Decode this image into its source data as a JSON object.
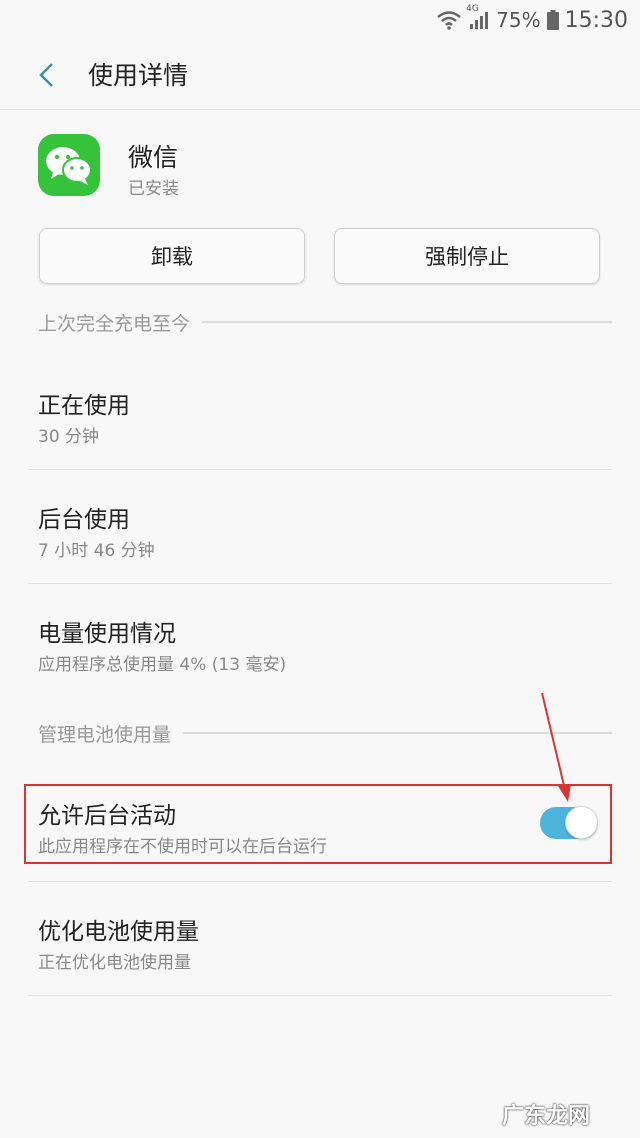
{
  "status_bar": {
    "network": "4G",
    "battery": "75%",
    "time": "15:30"
  },
  "header": {
    "title": "使用详情"
  },
  "app": {
    "name": "微信",
    "status": "已安装",
    "icon": "wechat-icon",
    "icon_color": "#35c33b"
  },
  "buttons": {
    "uninstall": "卸载",
    "force_stop": "强制停止"
  },
  "sections": {
    "since_charge": "上次完全充电至今",
    "manage_battery": "管理电池使用量"
  },
  "usage_items": [
    {
      "title": "正在使用",
      "subtitle": "30 分钟"
    },
    {
      "title": "后台使用",
      "subtitle": "7 小时 46 分钟"
    },
    {
      "title": "电量使用情况",
      "subtitle": "应用程序总使用量 4% (13 毫安)"
    }
  ],
  "battery_items": [
    {
      "title": "允许后台活动",
      "subtitle": "此应用程序在不使用时可以在后台运行",
      "toggle_on": true
    },
    {
      "title": "优化电池使用量",
      "subtitle": "正在优化电池使用量"
    }
  ],
  "colors": {
    "accent": "#4ab4dc",
    "highlight": "#dd3333"
  },
  "watermark": "广东龙网"
}
